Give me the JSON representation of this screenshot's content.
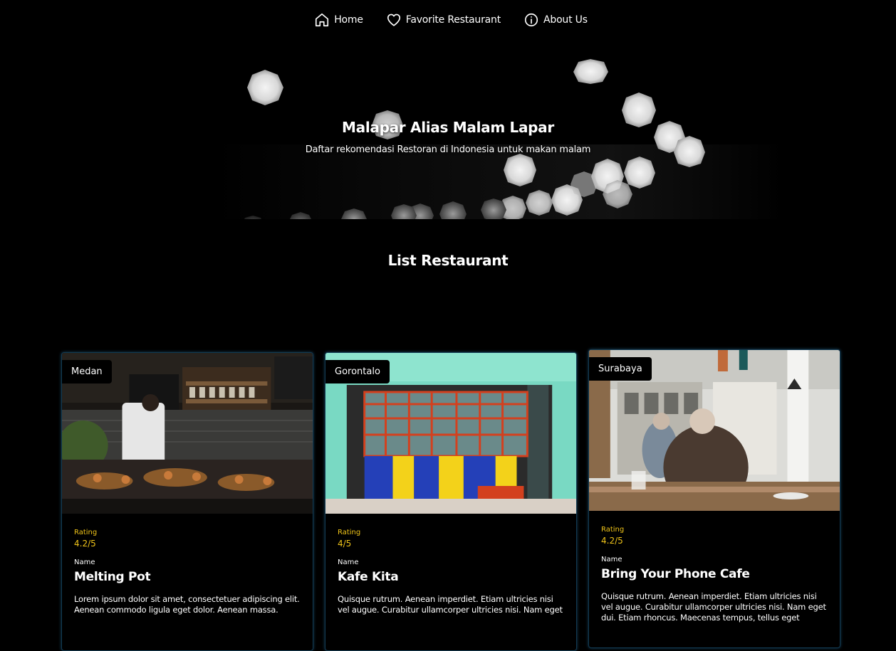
{
  "nav": {
    "items": [
      {
        "label": "Home",
        "icon": "home-icon"
      },
      {
        "label": "Favorite Restaurant",
        "icon": "heart-icon"
      },
      {
        "label": "About Us",
        "icon": "info-icon"
      }
    ]
  },
  "hero": {
    "title": "Malapar Alias Malam Lapar",
    "subtitle": "Daftar rekomendasi Restoran di Indonesia untuk makan malam"
  },
  "list": {
    "title": "List Restaurant",
    "rating_label": "Rating",
    "name_label": "Name"
  },
  "restaurants": [
    {
      "city": "Medan",
      "rating": "4.2/5",
      "name": "Melting Pot",
      "description": "Lorem ipsum dolor sit amet, consectetuer adipiscing elit. Aenean commodo ligula eget dolor. Aenean massa."
    },
    {
      "city": "Gorontalo",
      "rating": "4/5",
      "name": "Kafe Kita",
      "description": "Quisque rutrum. Aenean imperdiet. Etiam ultricies nisi vel augue. Curabitur ullamcorper ultricies nisi. Nam eget"
    },
    {
      "city": "Surabaya",
      "rating": "4.2/5",
      "name": "Bring Your Phone Cafe",
      "description": "Quisque rutrum. Aenean imperdiet. Etiam ultricies nisi vel augue. Curabitur ullamcorper ultricies nisi. Nam eget dui. Etiam rhoncus. Maecenas tempus, tellus eget"
    }
  ],
  "colors": {
    "background": "#000000",
    "rating": "#f0c419",
    "card_border": "#123a52"
  }
}
